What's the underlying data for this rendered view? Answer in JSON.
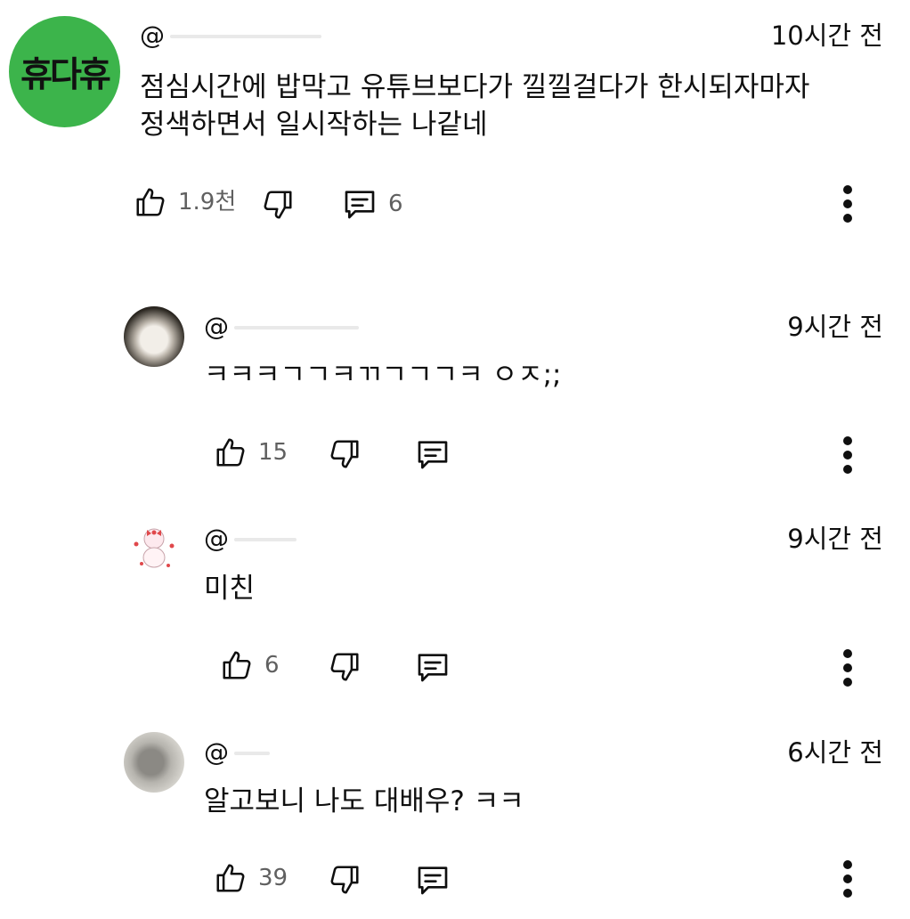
{
  "comments": [
    {
      "handle": "@",
      "time": "10시간 전",
      "avatar_text": "휴다휴",
      "text_lines": [
        "점심시간에 밥막고 유튜브보다가 낄낄걸다가 한시되자마자",
        "정색하면서 일시작하는 나같네"
      ],
      "likes": "1.9천",
      "replies": "6"
    },
    {
      "handle": "@",
      "time": "9시간 전",
      "text_lines": [
        "ㅋㅋㅋㄱㄱㅋㄲㄱㄱㄱㅋ ㅇㅈ;;"
      ],
      "likes": "15"
    },
    {
      "handle": "@",
      "time": "9시간 전",
      "text_lines": [
        "미친"
      ],
      "likes": "6"
    },
    {
      "handle": "@",
      "time": "6시간 전",
      "text_lines": [
        "알고보니 나도 대배우? ㅋㅋ"
      ],
      "likes": "39"
    }
  ],
  "icons": {
    "like": "thumbs-up-icon",
    "dislike": "thumbs-down-icon",
    "reply": "comment-icon",
    "more": "more-vertical-icon"
  },
  "colors": {
    "avatar_green": "#3cb44b",
    "text": "#0f0f0f",
    "secondary_text": "#606060"
  }
}
